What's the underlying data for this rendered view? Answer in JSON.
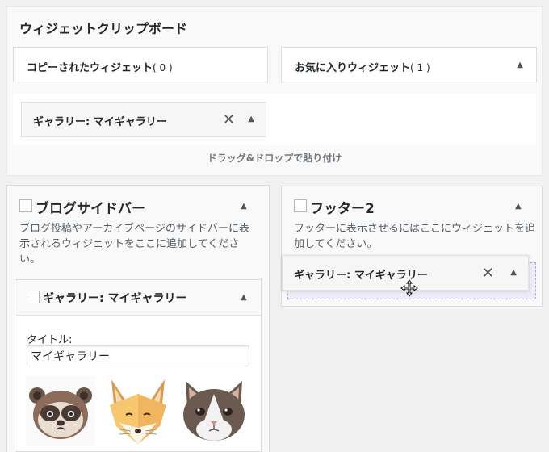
{
  "clipboard": {
    "title": "ウィジェットクリップボード",
    "copied_label": "コピーされたウィジェット",
    "copied_count": "( 0 )",
    "favorites_label": "お気に入りウィジェット",
    "favorites_count": "( 1 )",
    "gallery_item_label": "ギャラリー: マイギャラリー",
    "drop_hint": "ドラッグ&ドロップで貼り付け",
    "close_glyph": "✕",
    "caret_glyph": "▲"
  },
  "blog_sidebar": {
    "title": "ブログサイドバー",
    "description": "ブログ投稿やアーカイブページのサイドバーに表示されるウィジェットをここに追加してください。",
    "widget": {
      "label": "ギャラリー: マイギャラリー",
      "title_label": "タイトル:",
      "title_value": "マイギャラリー",
      "images": [
        "raccoon-dog-icon",
        "fox-icon",
        "cat-icon"
      ]
    }
  },
  "footer": {
    "title": "フッター2",
    "description": "フッターに表示させるにはここにウィジェットを追加してください。",
    "dragging_widget_label": "ギャラリー: マイギャラリー"
  },
  "colors": {
    "page_bg": "#f1f1f1",
    "panel_bg": "#f9f9f9",
    "placeholder_border": "#b4a8d6"
  }
}
